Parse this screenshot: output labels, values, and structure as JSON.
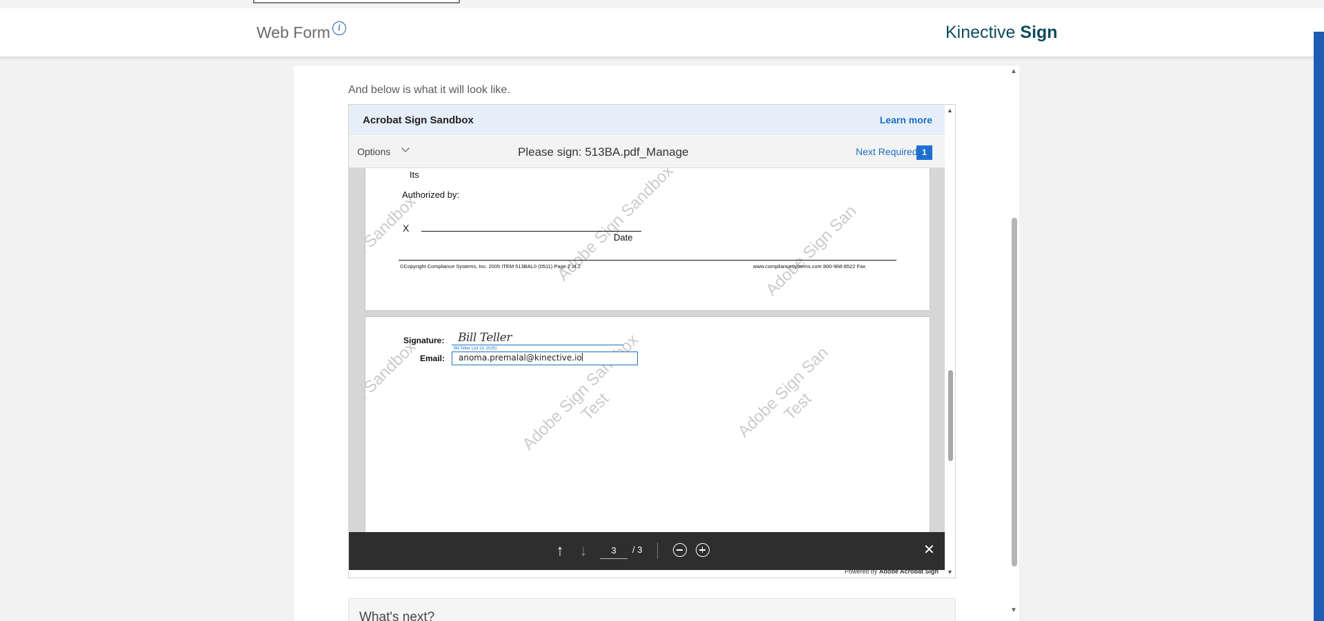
{
  "header": {
    "title": "Web Form",
    "info_icon": "info-icon",
    "brand_regular": "Kinective",
    "brand_bold": "Sign"
  },
  "intro_text": "And below is what it will look like.",
  "acrobat": {
    "frame_title": "Acrobat Sign Sandbox",
    "learn_more": "Learn more",
    "options_label": "Options",
    "document_title": "Please sign: 513BA.pdf_Manage",
    "next_required_label": "Next Required",
    "next_required_count": "1",
    "powered_prefix": "Powered by",
    "powered_brand": "Adobe Acrobat Sign"
  },
  "document": {
    "page2": {
      "its": "Its",
      "authorized_by": "Authorized by:",
      "x_mark": "X",
      "date_label": "Date",
      "copyright": "©Copyright Compliance Systems, Inc.  2005  ITEM 513BAL0  (0511)   Page 2 of 2",
      "website": "www.compliancesystems.com   800-968-8522 Fax"
    },
    "page3": {
      "signature_label": "Signature:",
      "signature_value": "Bill Teller",
      "signature_stamp": "Bill Teller    (Jul 14, 2025)",
      "email_label": "Email:",
      "email_value": "anoma.premalal@kinective.io"
    },
    "watermark_line1": "Adobe Sign Sandbox",
    "watermark_line2": "Test",
    "watermark_partial": "gn Sandbox",
    "watermark_partial_right": "Adobe Sign San"
  },
  "nav": {
    "current_page": "3",
    "total_pages": "/ 3"
  },
  "next_section_title": "What's next?",
  "colors": {
    "accent": "#1c6ec4",
    "brand": "#0f4c5c",
    "side_bar": "#1f5db5",
    "nav_bar": "#2e2e2e"
  }
}
